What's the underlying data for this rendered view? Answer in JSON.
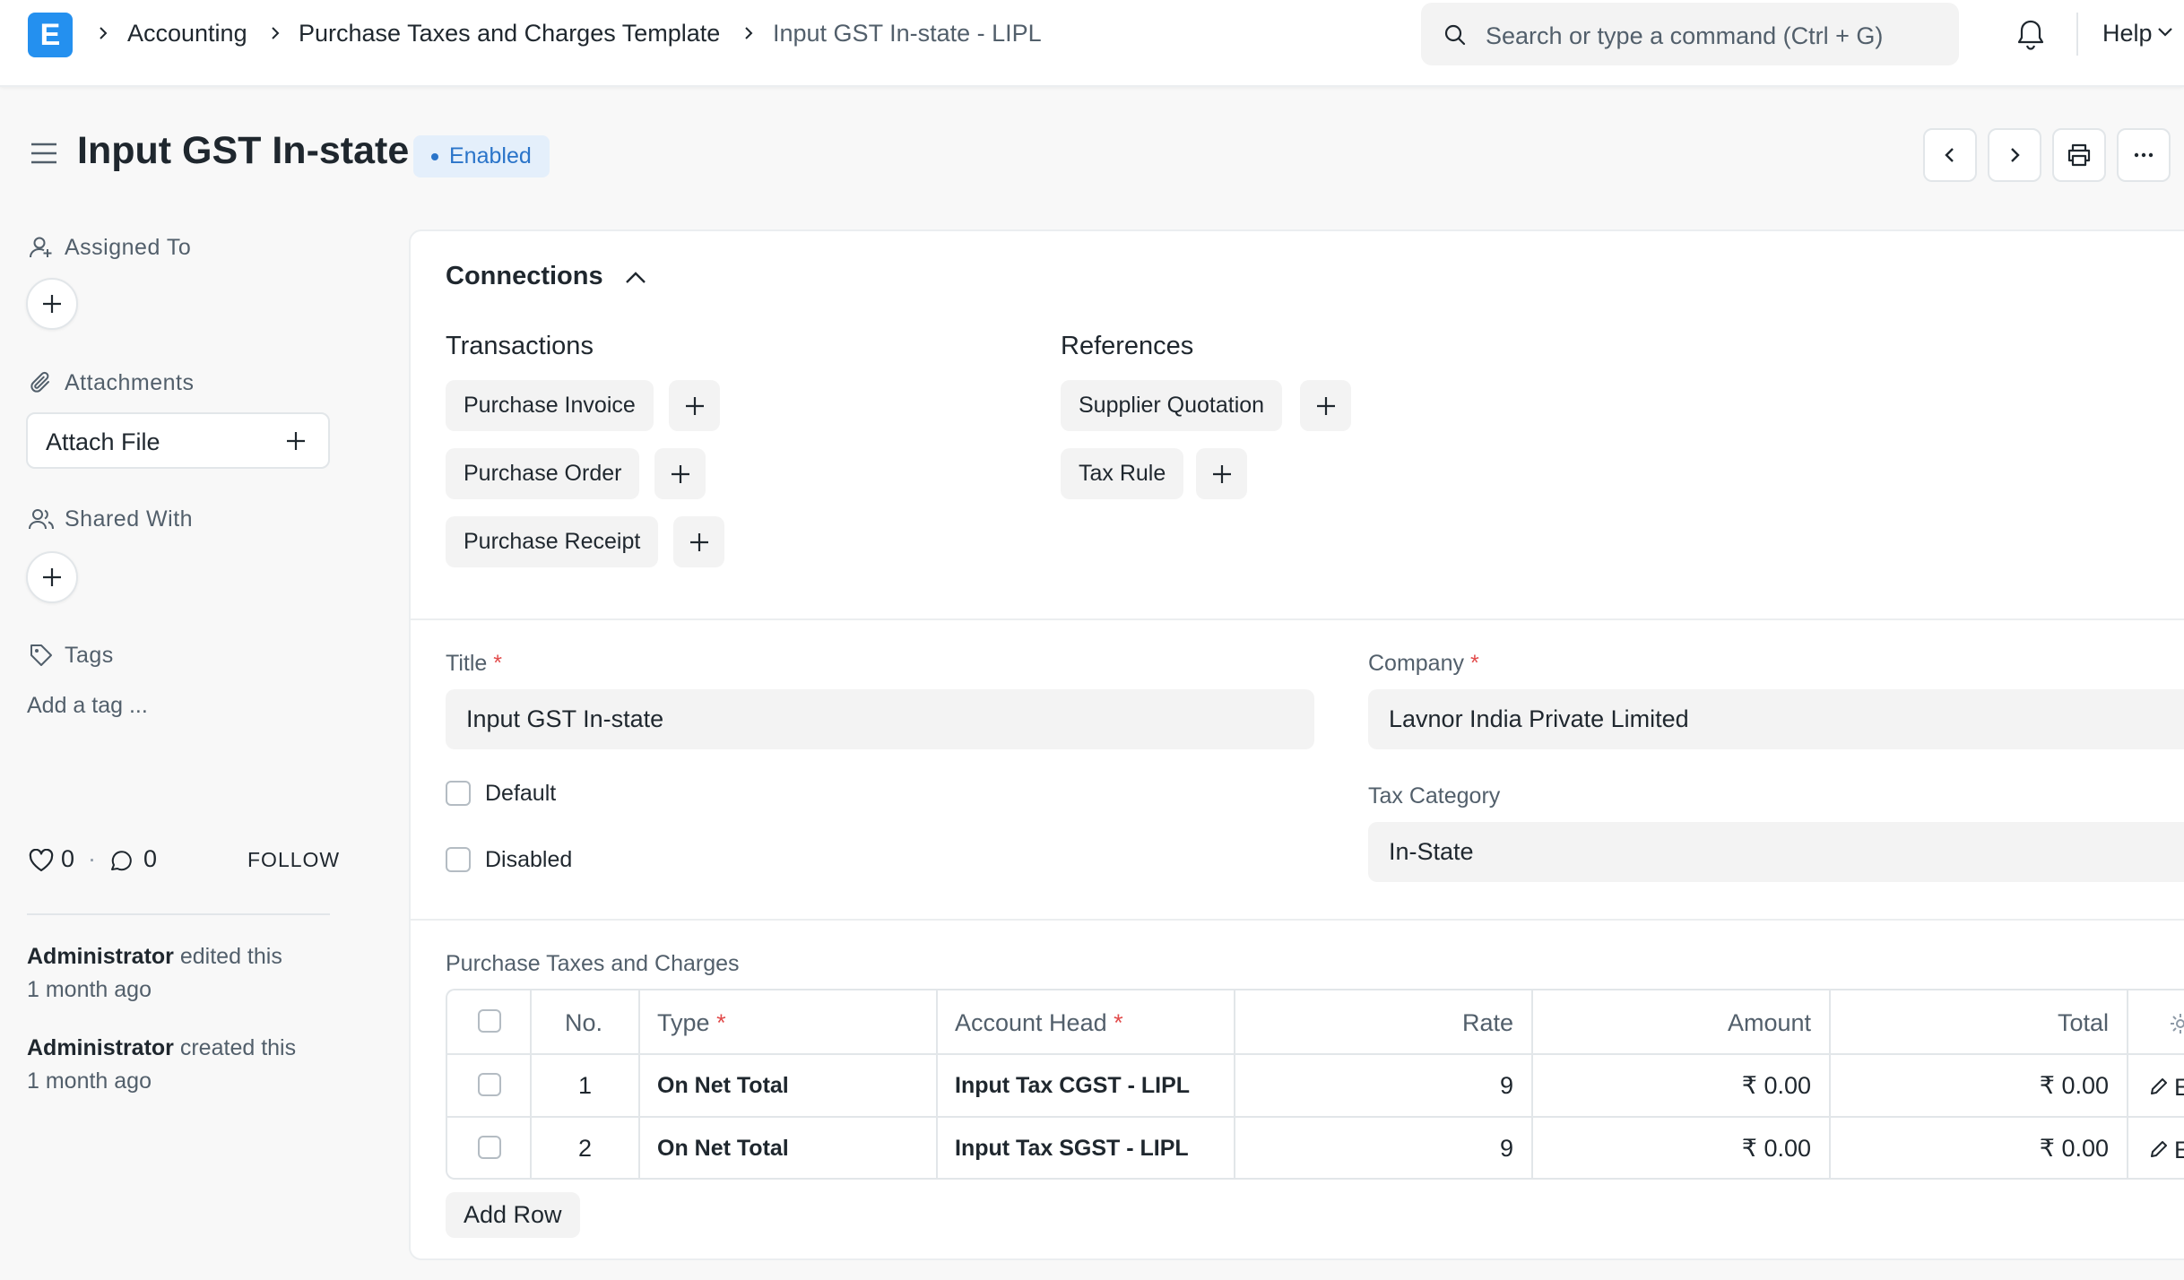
{
  "app": {
    "logo_letter": "E"
  },
  "breadcrumbs": [
    {
      "label": "Accounting"
    },
    {
      "label": "Purchase Taxes and Charges Template"
    },
    {
      "label": "Input GST In-state - LIPL"
    }
  ],
  "search": {
    "placeholder": "Search or type a command (Ctrl + G)"
  },
  "navbar": {
    "help_label": "Help"
  },
  "page": {
    "title": "Input GST In-state",
    "status": "Enabled"
  },
  "sidebar": {
    "assigned_to_label": "Assigned To",
    "attachments_label": "Attachments",
    "attach_file_label": "Attach File",
    "shared_with_label": "Shared With",
    "tags_label": "Tags",
    "tag_placeholder": "Add a tag ...",
    "likes": "0",
    "comments": "0",
    "follow_label": "FOLLOW",
    "activity": [
      {
        "user": "Administrator",
        "action": "edited this",
        "time": "1 month ago"
      },
      {
        "user": "Administrator",
        "action": "created this",
        "time": "1 month ago"
      }
    ]
  },
  "connections": {
    "title": "Connections",
    "transactions": {
      "heading": "Transactions",
      "items": [
        "Purchase Invoice",
        "Purchase Order",
        "Purchase Receipt"
      ]
    },
    "references": {
      "heading": "References",
      "items": [
        "Supplier Quotation",
        "Tax Rule"
      ]
    }
  },
  "form": {
    "title_label": "Title",
    "title_value": "Input GST In-state",
    "company_label": "Company",
    "company_value": "Lavnor India Private Limited",
    "default_label": "Default",
    "disabled_label": "Disabled",
    "tax_category_label": "Tax Category",
    "tax_category_value": "In-State",
    "required_mark": "*"
  },
  "taxes": {
    "label": "Purchase Taxes and Charges",
    "columns": {
      "no": "No.",
      "type": "Type",
      "account": "Account Head",
      "rate": "Rate",
      "amount": "Amount",
      "total": "Total"
    },
    "rows": [
      {
        "no": "1",
        "type": "On Net Total",
        "account": "Input Tax CGST - LIPL",
        "rate": "9",
        "amount": "₹ 0.00",
        "total": "₹ 0.00",
        "edit": "E"
      },
      {
        "no": "2",
        "type": "On Net Total",
        "account": "Input Tax SGST - LIPL",
        "rate": "9",
        "amount": "₹ 0.00",
        "total": "₹ 0.00",
        "edit": "E"
      }
    ],
    "add_row_label": "Add Row"
  }
}
